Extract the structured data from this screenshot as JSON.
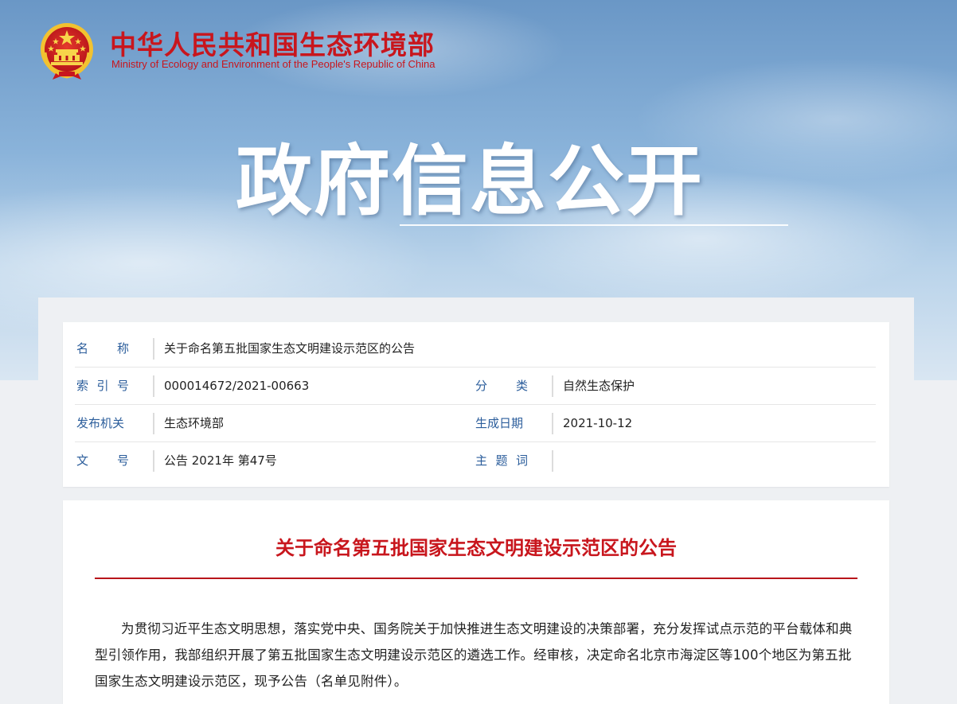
{
  "header": {
    "site_name_cn": "中华人民共和国生态环境部",
    "site_name_en": "Ministry of Ecology and Environment of the People's Republic of China",
    "hero_title": "政府信息公开",
    "emblem_icon": "national-emblem-icon"
  },
  "meta": {
    "name_label": [
      "名",
      "称"
    ],
    "name_value": "关于命名第五批国家生态文明建设示范区的公告",
    "index_label": [
      "索",
      "引",
      "号"
    ],
    "index_value": "000014672/2021-00663",
    "category_label": [
      "分",
      "类"
    ],
    "category_value": "自然生态保护",
    "issuer_label": "发布机关",
    "issuer_value": "生态环境部",
    "date_label": "生成日期",
    "date_value": "2021-10-12",
    "docno_label": [
      "文",
      "号"
    ],
    "docno_value": "公告 2021年 第47号",
    "keywords_label": [
      "主",
      "题",
      "词"
    ],
    "keywords_value": ""
  },
  "document": {
    "title": "关于命名第五批国家生态文明建设示范区的公告",
    "body": "为贯彻习近平生态文明思想，落实党中央、国务院关于加快推进生态文明建设的决策部署，充分发挥试点示范的平台载体和典型引领作用，我部组织开展了第五批国家生态文明建设示范区的遴选工作。经审核，决定命名北京市海淀区等100个地区为第五批国家生态文明建设示范区，现予公告（名单见附件）。"
  },
  "colors": {
    "brand_red": "#c8161d",
    "label_blue": "#2b5d9b"
  }
}
